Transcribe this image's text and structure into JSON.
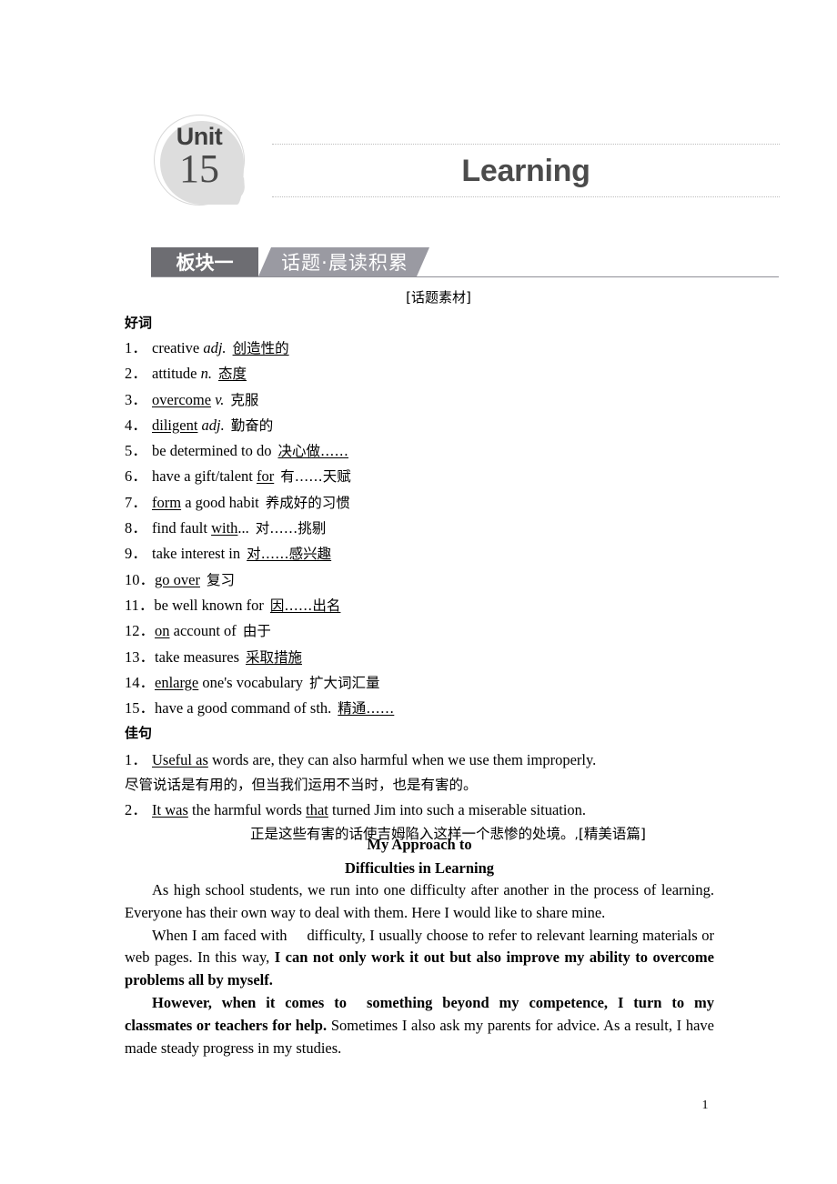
{
  "header": {
    "unit_word": "Unit",
    "unit_number": "15",
    "title": "Learning"
  },
  "banner": {
    "dark_label": "板块一",
    "light_label": "话题·晨读积累"
  },
  "material_label": "[话题素材]",
  "good_words": {
    "heading": "好词",
    "items": [
      {
        "num": "1．",
        "en_pre": "creative ",
        "pos": "adj.",
        "en_post": "",
        "cn": "创造性的",
        "underline": "cn"
      },
      {
        "num": "2．",
        "en_pre": "attitude ",
        "pos": "n.",
        "en_post": "",
        "cn": "态度",
        "underline": "cn"
      },
      {
        "num": "3．",
        "en_pre": "overcome",
        "pos": "v.",
        "en_post": "",
        "cn": "克服",
        "underline": "en-word"
      },
      {
        "num": "4．",
        "en_pre": "diligent",
        "pos": "adj.",
        "en_post": "",
        "cn": "勤奋的",
        "underline": "en-word"
      },
      {
        "num": "5．",
        "en_plain": "be determined to do",
        "cn": "决心做……",
        "underline": "cn"
      },
      {
        "num": "6．",
        "en_before": "have a gift/talent ",
        "en_under": "for",
        "en_after": "",
        "cn": "有……天赋",
        "underline": "en-part"
      },
      {
        "num": "7．",
        "en_before": "",
        "en_under": "form",
        "en_after": " a good habit",
        "cn": "养成好的习惯",
        "underline": "en-part"
      },
      {
        "num": "8．",
        "en_before": "find fault ",
        "en_under": "with",
        "en_after": "...",
        "cn": "对……挑剔",
        "underline": "en-part"
      },
      {
        "num": "9．",
        "en_plain": "take interest in",
        "cn": "对……感兴趣",
        "underline": "cn"
      },
      {
        "num": "10．",
        "en_before": "",
        "en_under": "go over",
        "en_after": "",
        "cn": "复习",
        "underline": "en-part"
      },
      {
        "num": "11．",
        "en_plain": "be well known for",
        "cn": "因……出名",
        "underline": "cn"
      },
      {
        "num": "12．",
        "en_before": "",
        "en_under": "on",
        "en_after": " account of",
        "cn": "由于",
        "underline": "en-part"
      },
      {
        "num": "13．",
        "en_plain": "take measures",
        "cn": "采取措施",
        "underline": "cn"
      },
      {
        "num": "14．",
        "en_before": "",
        "en_under": "enlarge",
        "en_after": " one's vocabulary",
        "cn": "扩大词汇量",
        "underline": "en-part"
      },
      {
        "num": "15．",
        "en_plain": "have a good command of sth.",
        "cn": "精通……",
        "underline": "cn"
      }
    ]
  },
  "good_sentences": {
    "heading": "佳句",
    "items": [
      {
        "num": "1．",
        "en_under": "Useful as",
        "en_rest": " words are, they can also harmful when we use them improperly.",
        "cn": "尽管说话是有用的，但当我们运用不当时，也是有害的。",
        "cn_indent": false,
        "tag": ""
      },
      {
        "num": "2．",
        "en_under": "It was",
        "en_mid": " the harmful words ",
        "en_under2": "that",
        "en_rest": " turned Jim into such a miserable situation.",
        "cn": "正是这些有害的话使吉姆陷入这样一个悲惨的处境。",
        "cn_indent": true,
        "tag_comma": ",",
        "tag": "[精美语篇]"
      }
    ]
  },
  "essay": {
    "title_line1": "My Approach to",
    "title_line2": "Difficulties in Learning",
    "paragraphs": [
      {
        "parts": [
          {
            "text": "As high school students, we run into one difficulty after another in the process of learning. Everyone has their own way to deal with them. Here I would like to share mine.",
            "bold": false
          }
        ]
      },
      {
        "parts": [
          {
            "text": "When I am faced with",
            "bold": false
          },
          {
            "blank": true
          },
          {
            "text": "difficulty, I usually choose to refer to relevant learning materials or web pages. In this way, ",
            "bold": false
          },
          {
            "text": "I can not only work it out but also improve my ability to overcome problems all by myself.",
            "bold": true
          }
        ]
      },
      {
        "parts": [
          {
            "text": "However, when it comes to",
            "bold": true
          },
          {
            "blank": true
          },
          {
            "text": "something beyond my competence, I turn to my classmates or teachers for help.",
            "bold": true
          },
          {
            "text": " Sometimes I also ask my parents for advice. As a result, I have made steady progress in my studies.",
            "bold": false
          }
        ]
      }
    ]
  },
  "page_number": "1",
  "colors": {
    "banner_dark": "#6d6d72",
    "banner_light": "#9a9aa2",
    "title_gray": "#4b4b4b",
    "badge_gray": "#dddddd"
  }
}
